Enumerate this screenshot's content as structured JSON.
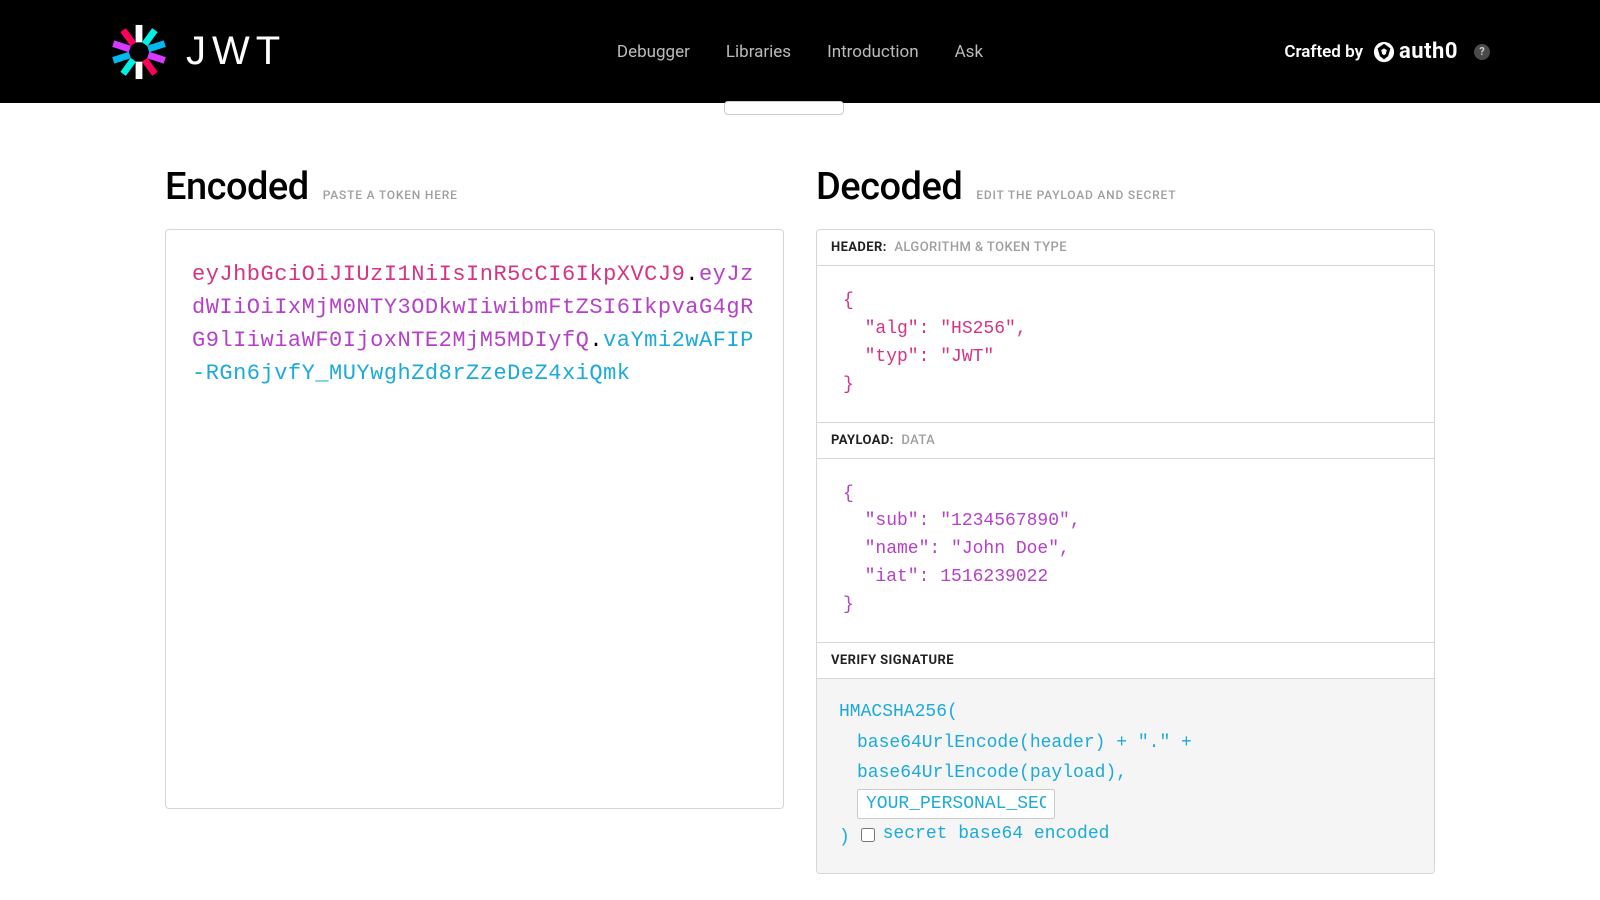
{
  "nav": {
    "debugger": "Debugger",
    "libraries": "Libraries",
    "introduction": "Introduction",
    "ask": "Ask"
  },
  "crafted": {
    "label": "Crafted by",
    "brand": "auth0"
  },
  "encoded": {
    "title": "Encoded",
    "sub": "PASTE A TOKEN HERE",
    "token_header": "eyJhbGciOiJIUzI1NiIsInR5cCI6IkpXVCJ9",
    "token_payload": "eyJzdWIiOiIxMjM0NTY3ODkwIiwibmFtZSI6IkpvaG4gRG9lIiwiaWF0IjoxNTE2MjM5MDIyfQ",
    "token_signature": "vaYmi2wAFIP-RGn6jvfY_MUYwghZd8rZzeDeZ4xiQmk"
  },
  "decoded": {
    "title": "Decoded",
    "sub": "EDIT THE PAYLOAD AND SECRET",
    "header_label": "HEADER:",
    "header_hint": "ALGORITHM & TOKEN TYPE",
    "header_json": "{\n  \"alg\": \"HS256\",\n  \"typ\": \"JWT\"\n}",
    "payload_label": "PAYLOAD:",
    "payload_hint": "DATA",
    "payload_json": "{\n  \"sub\": \"1234567890\",\n  \"name\": \"John Doe\",\n  \"iat\": 1516239022\n}",
    "sig_label": "VERIFY SIGNATURE",
    "sig_fn": "HMACSHA256(",
    "sig_l1": "base64UrlEncode(header) + \".\" +",
    "sig_l2": "base64UrlEncode(payload),",
    "sig_secret": "YOUR_PERSONAL_SECRET",
    "sig_close": ")",
    "sig_base64_label": "secret base64 encoded"
  }
}
